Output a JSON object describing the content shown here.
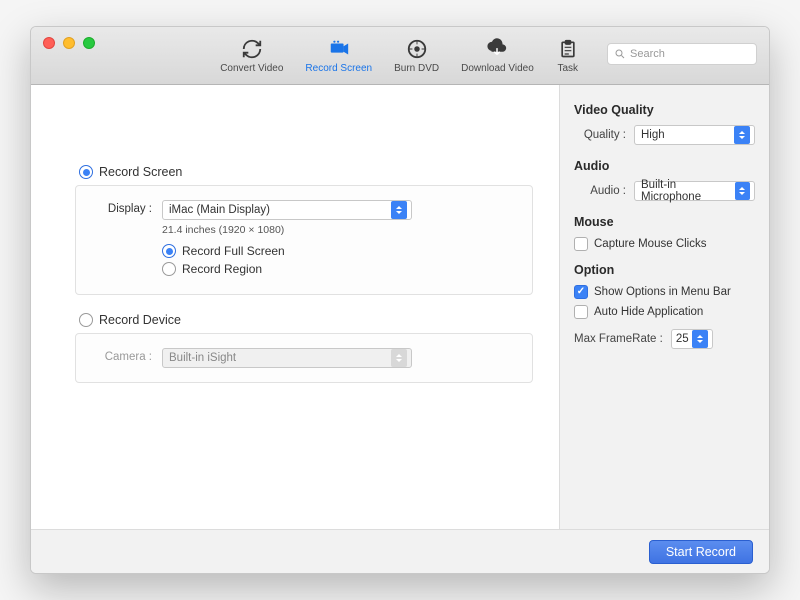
{
  "toolbar": {
    "items": [
      {
        "label": "Convert Video",
        "icon": "convert-icon"
      },
      {
        "label": "Record Screen",
        "icon": "record-icon"
      },
      {
        "label": "Burn DVD",
        "icon": "disc-icon"
      },
      {
        "label": "Download Video",
        "icon": "download-icon"
      },
      {
        "label": "Task",
        "icon": "task-icon"
      }
    ],
    "search_placeholder": "Search"
  },
  "main": {
    "record_screen": {
      "title": "Record Screen",
      "display_label": "Display :",
      "display_value": "iMac (Main Display)",
      "display_info": "21.4 inches (1920 × 1080)",
      "mode_full": "Record Full Screen",
      "mode_region": "Record Region"
    },
    "record_device": {
      "title": "Record Device",
      "camera_label": "Camera :",
      "camera_value": "Built-in iSight"
    }
  },
  "sidebar": {
    "video_quality": {
      "title": "Video Quality",
      "quality_label": "Quality :",
      "quality_value": "High"
    },
    "audio": {
      "title": "Audio",
      "audio_label": "Audio :",
      "audio_value": "Built-in Microphone"
    },
    "mouse": {
      "title": "Mouse",
      "capture_clicks": "Capture Mouse Clicks"
    },
    "option": {
      "title": "Option",
      "show_menu": "Show Options in Menu Bar",
      "auto_hide": "Auto Hide Application",
      "max_fr_label": "Max FrameRate :",
      "max_fr_value": "25"
    }
  },
  "footer": {
    "start_record": "Start Record"
  }
}
